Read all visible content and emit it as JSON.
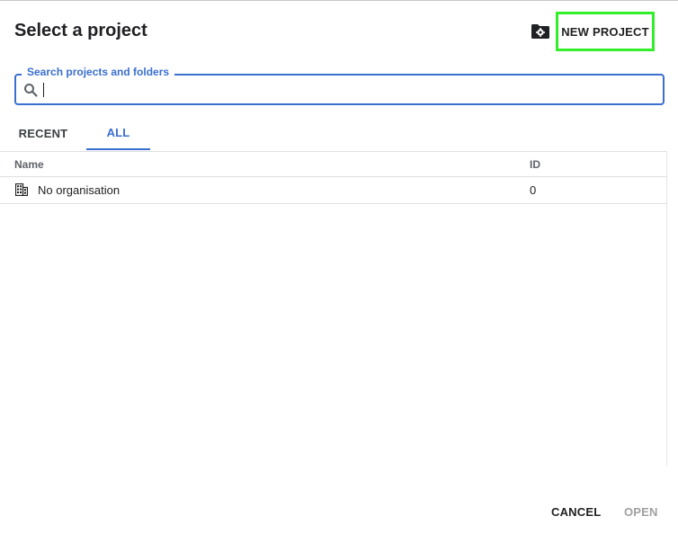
{
  "dialog": {
    "title": "Select a project",
    "new_project_label": "NEW PROJECT",
    "folder_settings_icon": "folder-gear-icon",
    "accent_color": "#3a6fd0",
    "highlight_color": "#33ee2a"
  },
  "search": {
    "label": "Search projects and folders",
    "value": "",
    "icon": "search-icon"
  },
  "tabs": [
    {
      "label": "RECENT",
      "active": false
    },
    {
      "label": "ALL",
      "active": true
    }
  ],
  "table": {
    "columns": [
      "Name",
      "ID"
    ],
    "rows": [
      {
        "icon": "organisation-icon",
        "name": "No organisation",
        "id": "0"
      }
    ]
  },
  "footer": {
    "cancel_label": "CANCEL",
    "open_label": "OPEN"
  }
}
